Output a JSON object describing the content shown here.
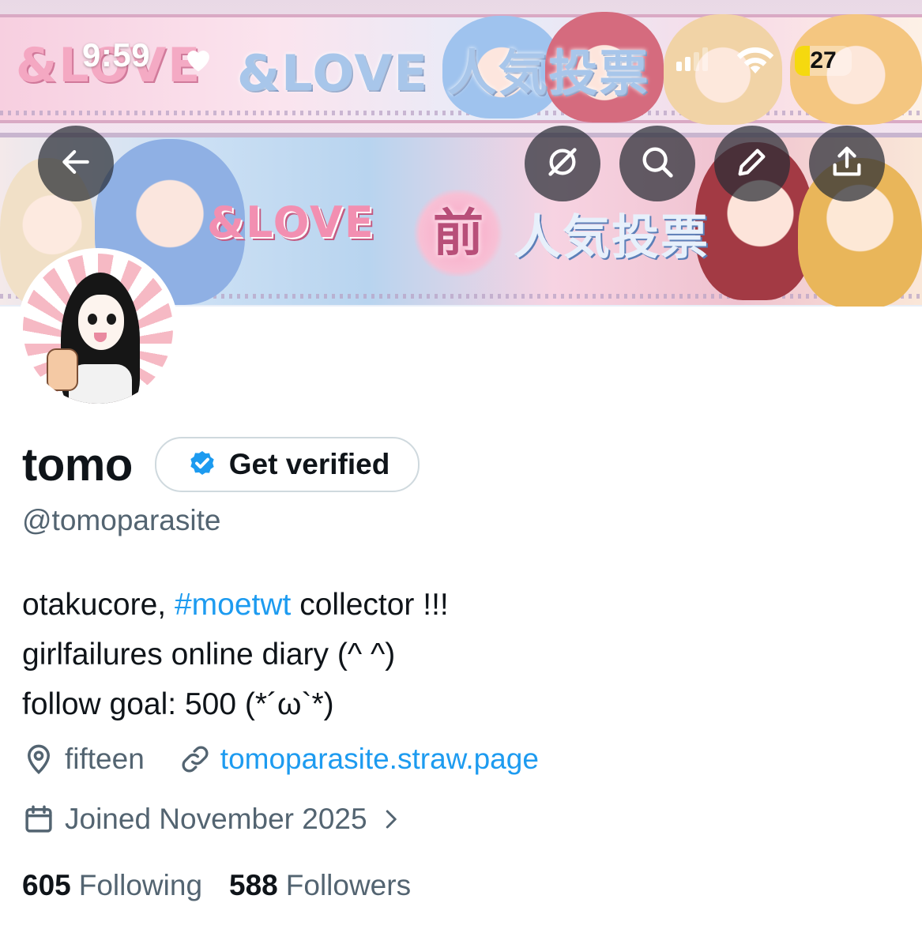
{
  "status_bar": {
    "time": "9:59",
    "battery_level": "27",
    "battery_fraction": 0.27
  },
  "banner": {
    "top_text": "&LOVE 人気投票",
    "love_text": "&LOVE",
    "mid_text": "前",
    "bottom_text": "人気投票"
  },
  "header_actions": {
    "back_icon": "arrow-left-icon",
    "grok_icon": "grok-icon",
    "search_icon": "search-icon",
    "edit_icon": "pencil-icon",
    "share_icon": "share-icon"
  },
  "profile": {
    "display_name": "tomo",
    "get_verified_label": "Get verified",
    "handle": "@tomoparasite",
    "bio": {
      "line1_prefix": "otakucore, ",
      "line1_hashtag": "#moetwt",
      "line1_suffix": " collector !!!",
      "line2": "girlfailures online diary (^ ^)",
      "line3": "follow goal: 500 (*´ω`*)"
    },
    "location": "fifteen",
    "website": "tomoparasite.straw.page",
    "joined": "Joined November 2025",
    "following_count": "605",
    "following_label": "Following",
    "followers_count": "588",
    "followers_label": "Followers"
  },
  "colors": {
    "accent": "#1d9bf0",
    "secondary_text": "#536471",
    "primary_text": "#0f1419",
    "battery": "#f5d90f"
  }
}
